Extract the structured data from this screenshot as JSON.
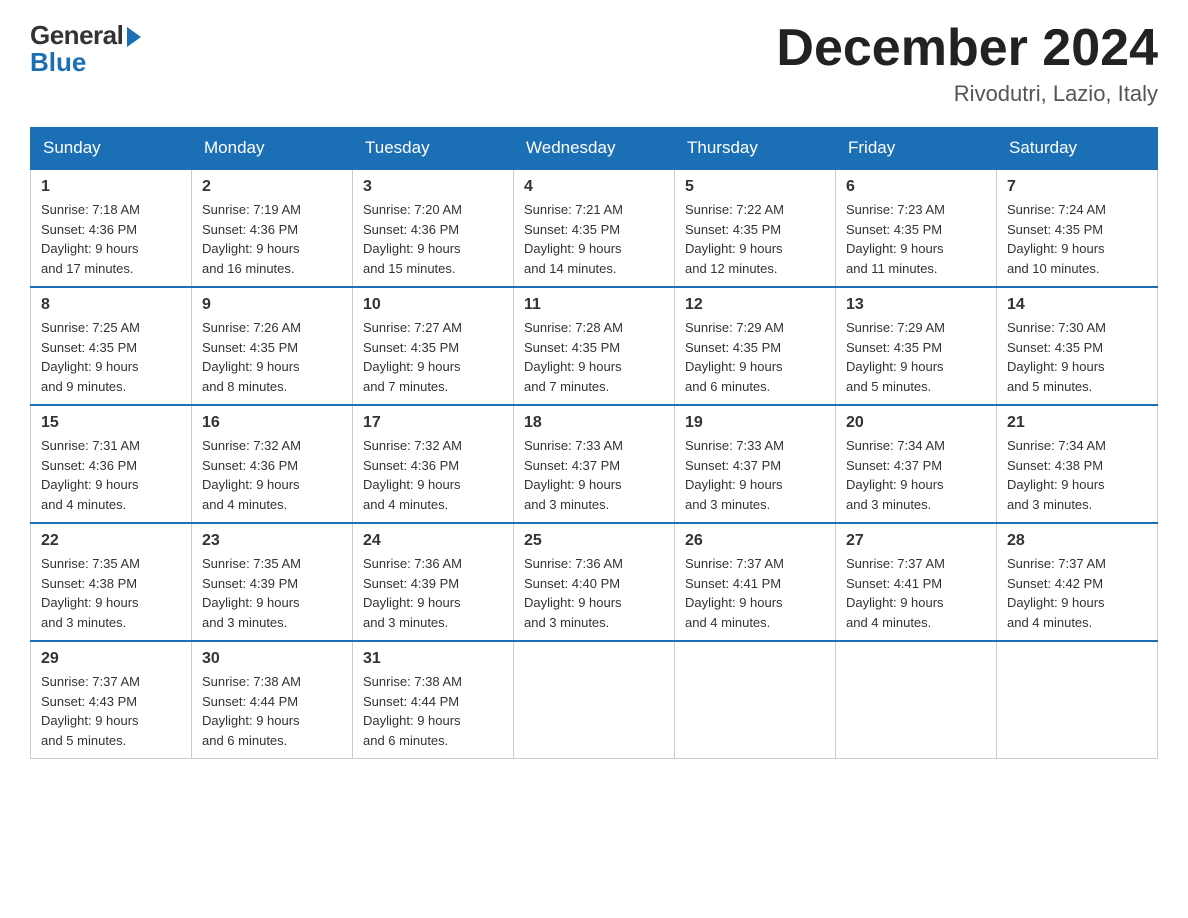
{
  "header": {
    "logo_general": "General",
    "logo_blue": "Blue",
    "month_title": "December 2024",
    "location": "Rivodutri, Lazio, Italy"
  },
  "days_of_week": [
    "Sunday",
    "Monday",
    "Tuesday",
    "Wednesday",
    "Thursday",
    "Friday",
    "Saturday"
  ],
  "weeks": [
    [
      {
        "day": "1",
        "sunrise": "7:18 AM",
        "sunset": "4:36 PM",
        "daylight": "9 hours and 17 minutes."
      },
      {
        "day": "2",
        "sunrise": "7:19 AM",
        "sunset": "4:36 PM",
        "daylight": "9 hours and 16 minutes."
      },
      {
        "day": "3",
        "sunrise": "7:20 AM",
        "sunset": "4:36 PM",
        "daylight": "9 hours and 15 minutes."
      },
      {
        "day": "4",
        "sunrise": "7:21 AM",
        "sunset": "4:35 PM",
        "daylight": "9 hours and 14 minutes."
      },
      {
        "day": "5",
        "sunrise": "7:22 AM",
        "sunset": "4:35 PM",
        "daylight": "9 hours and 12 minutes."
      },
      {
        "day": "6",
        "sunrise": "7:23 AM",
        "sunset": "4:35 PM",
        "daylight": "9 hours and 11 minutes."
      },
      {
        "day": "7",
        "sunrise": "7:24 AM",
        "sunset": "4:35 PM",
        "daylight": "9 hours and 10 minutes."
      }
    ],
    [
      {
        "day": "8",
        "sunrise": "7:25 AM",
        "sunset": "4:35 PM",
        "daylight": "9 hours and 9 minutes."
      },
      {
        "day": "9",
        "sunrise": "7:26 AM",
        "sunset": "4:35 PM",
        "daylight": "9 hours and 8 minutes."
      },
      {
        "day": "10",
        "sunrise": "7:27 AM",
        "sunset": "4:35 PM",
        "daylight": "9 hours and 7 minutes."
      },
      {
        "day": "11",
        "sunrise": "7:28 AM",
        "sunset": "4:35 PM",
        "daylight": "9 hours and 7 minutes."
      },
      {
        "day": "12",
        "sunrise": "7:29 AM",
        "sunset": "4:35 PM",
        "daylight": "9 hours and 6 minutes."
      },
      {
        "day": "13",
        "sunrise": "7:29 AM",
        "sunset": "4:35 PM",
        "daylight": "9 hours and 5 minutes."
      },
      {
        "day": "14",
        "sunrise": "7:30 AM",
        "sunset": "4:35 PM",
        "daylight": "9 hours and 5 minutes."
      }
    ],
    [
      {
        "day": "15",
        "sunrise": "7:31 AM",
        "sunset": "4:36 PM",
        "daylight": "9 hours and 4 minutes."
      },
      {
        "day": "16",
        "sunrise": "7:32 AM",
        "sunset": "4:36 PM",
        "daylight": "9 hours and 4 minutes."
      },
      {
        "day": "17",
        "sunrise": "7:32 AM",
        "sunset": "4:36 PM",
        "daylight": "9 hours and 4 minutes."
      },
      {
        "day": "18",
        "sunrise": "7:33 AM",
        "sunset": "4:37 PM",
        "daylight": "9 hours and 3 minutes."
      },
      {
        "day": "19",
        "sunrise": "7:33 AM",
        "sunset": "4:37 PM",
        "daylight": "9 hours and 3 minutes."
      },
      {
        "day": "20",
        "sunrise": "7:34 AM",
        "sunset": "4:37 PM",
        "daylight": "9 hours and 3 minutes."
      },
      {
        "day": "21",
        "sunrise": "7:34 AM",
        "sunset": "4:38 PM",
        "daylight": "9 hours and 3 minutes."
      }
    ],
    [
      {
        "day": "22",
        "sunrise": "7:35 AM",
        "sunset": "4:38 PM",
        "daylight": "9 hours and 3 minutes."
      },
      {
        "day": "23",
        "sunrise": "7:35 AM",
        "sunset": "4:39 PM",
        "daylight": "9 hours and 3 minutes."
      },
      {
        "day": "24",
        "sunrise": "7:36 AM",
        "sunset": "4:39 PM",
        "daylight": "9 hours and 3 minutes."
      },
      {
        "day": "25",
        "sunrise": "7:36 AM",
        "sunset": "4:40 PM",
        "daylight": "9 hours and 3 minutes."
      },
      {
        "day": "26",
        "sunrise": "7:37 AM",
        "sunset": "4:41 PM",
        "daylight": "9 hours and 4 minutes."
      },
      {
        "day": "27",
        "sunrise": "7:37 AM",
        "sunset": "4:41 PM",
        "daylight": "9 hours and 4 minutes."
      },
      {
        "day": "28",
        "sunrise": "7:37 AM",
        "sunset": "4:42 PM",
        "daylight": "9 hours and 4 minutes."
      }
    ],
    [
      {
        "day": "29",
        "sunrise": "7:37 AM",
        "sunset": "4:43 PM",
        "daylight": "9 hours and 5 minutes."
      },
      {
        "day": "30",
        "sunrise": "7:38 AM",
        "sunset": "4:44 PM",
        "daylight": "9 hours and 6 minutes."
      },
      {
        "day": "31",
        "sunrise": "7:38 AM",
        "sunset": "4:44 PM",
        "daylight": "9 hours and 6 minutes."
      },
      null,
      null,
      null,
      null
    ]
  ],
  "labels": {
    "sunrise": "Sunrise:",
    "sunset": "Sunset:",
    "daylight": "Daylight:"
  }
}
